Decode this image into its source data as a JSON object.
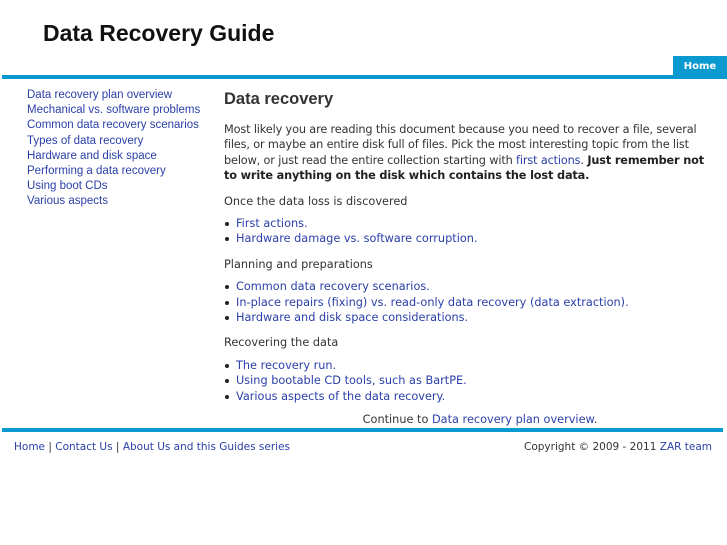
{
  "header": {
    "site_title": "Data Recovery Guide",
    "nav": {
      "home_label": "Home"
    },
    "accent_color": "#0a9ad0"
  },
  "sidebar": {
    "items": [
      {
        "label": "Data recovery plan overview"
      },
      {
        "label": "Mechanical vs. software problems"
      },
      {
        "label": "Common data recovery scenarios"
      },
      {
        "label": "Types of data recovery"
      },
      {
        "label": "Hardware and disk space"
      },
      {
        "label": "Performing a data recovery"
      },
      {
        "label": "Using boot CDs"
      },
      {
        "label": "Various aspects"
      }
    ]
  },
  "main": {
    "title": "Data recovery",
    "intro": {
      "text_before": "Most likely you are reading this document because you need to recover a file, several files, or maybe an entire disk full of files. Pick the most interesting topic from the list below, or just read the entire collection starting with ",
      "link": "first actions",
      "text_after": ". ",
      "bold": "Just remember not to write anything on the disk which contains the lost data."
    },
    "sections": [
      {
        "label": "Once the data loss is discovered",
        "items": [
          "First actions.",
          "Hardware damage vs. software corruption."
        ]
      },
      {
        "label": "Planning and preparations",
        "items": [
          "Common data recovery scenarios.",
          "In-place repairs (fixing) vs. read-only data recovery (data extraction).",
          "Hardware and disk space considerations."
        ]
      },
      {
        "label": "Recovering the data",
        "items": [
          "The recovery run.",
          "Using bootable CD tools, such as BartPE.",
          "Various aspects of the data recovery."
        ]
      }
    ],
    "continue": {
      "prefix": "Continue to ",
      "link": "Data recovery plan overview",
      "suffix": "."
    }
  },
  "footer": {
    "links": [
      "Home",
      "Contact Us",
      "About Us and this Guides series"
    ],
    "separator": " | ",
    "copyright_text": "Copyright © 2009 - 2011 ",
    "copyright_link": "ZAR team"
  }
}
